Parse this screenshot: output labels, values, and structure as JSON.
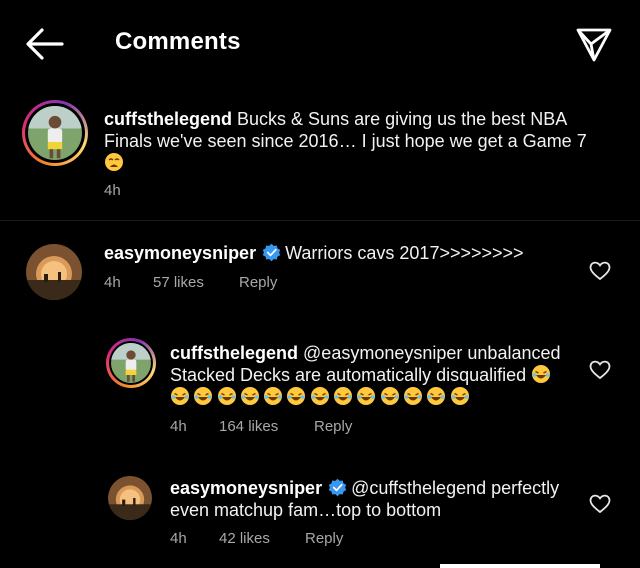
{
  "header": {
    "title": "Comments",
    "back_icon": "back-arrow-icon",
    "send_icon": "paper-plane-icon"
  },
  "caption": {
    "username": "cuffsthelegend",
    "text": "Bucks & Suns are giving us the best NBA Finals we've seen since 2016… I just hope we get a Game 7",
    "emoji": "😩",
    "time": "4h"
  },
  "comments": [
    {
      "username": "easymoneysniper",
      "verified": true,
      "text": "Warriors cavs 2017>>>>>>>>",
      "time": "4h",
      "likes": "57 likes",
      "reply_label": "Reply"
    },
    {
      "username": "cuffsthelegend",
      "mention": "@easymoneysniper",
      "text_line1": "unbalanced",
      "text_line2": "Stacked Decks are automatically disqualified",
      "emoji": "😂",
      "time": "4h",
      "likes": "164 likes",
      "reply_label": "Reply"
    },
    {
      "username": "easymoneysniper",
      "verified": true,
      "mention": "@cuffsthelegend",
      "text_line1": "perfectly",
      "text_line2": "even matchup fam…top to bottom",
      "time": "4h",
      "likes": "42 likes",
      "reply_label": "Reply"
    }
  ],
  "colors": {
    "background": "#000000",
    "text": "#ffffff",
    "meta": "#a8a8a8",
    "verified": "#3897f0"
  }
}
